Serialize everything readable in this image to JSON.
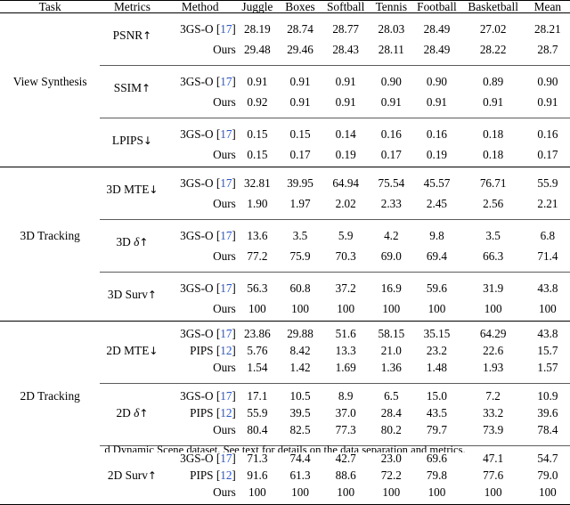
{
  "table": {
    "columns": {
      "task": "Task",
      "metrics": "Metrics",
      "method": "Method",
      "scenes": [
        "Juggle",
        "Boxes",
        "Softball",
        "Tennis",
        "Football",
        "Basketball"
      ],
      "mean": "Mean"
    },
    "citation_color": "#2b56c8",
    "methods": {
      "baseline_3gso": "3GS-O",
      "baseline_3gso_cite": "17",
      "baseline_pips": "PIPS",
      "baseline_pips_cite": "12",
      "ours": "Ours"
    },
    "sections": [
      {
        "task": "View Synthesis",
        "groups": [
          {
            "metric": "PSNR",
            "arrow": "↑",
            "rows": [
              {
                "method": "3GS-O",
                "cite": "17",
                "values": [
                  "28.19",
                  "28.74",
                  "28.77",
                  "28.03",
                  "28.49",
                  "27.02",
                  "28.21"
                ],
                "bold": [
                  false,
                  false,
                  true,
                  false,
                  true,
                  false,
                  false
                ]
              },
              {
                "method": "Ours",
                "cite": null,
                "values": [
                  "29.48",
                  "29.46",
                  "28.43",
                  "28.11",
                  "28.49",
                  "28.22",
                  "28.7"
                ],
                "bold": [
                  true,
                  true,
                  false,
                  true,
                  true,
                  true,
                  true
                ]
              }
            ]
          },
          {
            "metric": "SSIM",
            "arrow": "↑",
            "rows": [
              {
                "method": "3GS-O",
                "cite": "17",
                "values": [
                  "0.91",
                  "0.91",
                  "0.91",
                  "0.90",
                  "0.90",
                  "0.89",
                  "0.90"
                ],
                "bold": [
                  false,
                  true,
                  true,
                  false,
                  false,
                  false,
                  false
                ]
              },
              {
                "method": "Ours",
                "cite": null,
                "values": [
                  "0.92",
                  "0.91",
                  "0.91",
                  "0.91",
                  "0.91",
                  "0.91",
                  "0.91"
                ],
                "bold": [
                  true,
                  true,
                  true,
                  true,
                  true,
                  true,
                  true
                ]
              }
            ]
          },
          {
            "metric": "LPIPS",
            "arrow": "↓",
            "rows": [
              {
                "method": "3GS-O",
                "cite": "17",
                "values": [
                  "0.15",
                  "0.15",
                  "0.14",
                  "0.16",
                  "0.16",
                  "0.18",
                  "0.16"
                ],
                "bold": [
                  true,
                  true,
                  true,
                  true,
                  true,
                  true,
                  true
                ]
              },
              {
                "method": "Ours",
                "cite": null,
                "values": [
                  "0.15",
                  "0.17",
                  "0.19",
                  "0.17",
                  "0.19",
                  "0.18",
                  "0.17"
                ],
                "bold": [
                  true,
                  false,
                  false,
                  false,
                  false,
                  true,
                  true
                ]
              }
            ]
          }
        ]
      },
      {
        "task": "3D Tracking",
        "groups": [
          {
            "metric": "3D MTE",
            "arrow": "↓",
            "rows": [
              {
                "method": "3GS-O",
                "cite": "17",
                "values": [
                  "32.81",
                  "39.95",
                  "64.94",
                  "75.54",
                  "45.57",
                  "76.71",
                  "55.9"
                ],
                "bold": [
                  false,
                  false,
                  false,
                  false,
                  false,
                  false,
                  false
                ]
              },
              {
                "method": "Ours",
                "cite": null,
                "values": [
                  "1.90",
                  "1.97",
                  "2.02",
                  "2.33",
                  "2.45",
                  "2.56",
                  "2.21"
                ],
                "bold": [
                  true,
                  true,
                  true,
                  true,
                  true,
                  true,
                  true
                ]
              }
            ]
          },
          {
            "metric": "3D δ",
            "arrow": "↑",
            "italic_symbol": true,
            "rows": [
              {
                "method": "3GS-O",
                "cite": "17",
                "values": [
                  "13.6",
                  "3.5",
                  "5.9",
                  "4.2",
                  "9.8",
                  "3.5",
                  "6.8"
                ],
                "bold": [
                  false,
                  false,
                  false,
                  false,
                  false,
                  false,
                  false
                ]
              },
              {
                "method": "Ours",
                "cite": null,
                "values": [
                  "77.2",
                  "75.9",
                  "70.3",
                  "69.0",
                  "69.4",
                  "66.3",
                  "71.4"
                ],
                "bold": [
                  true,
                  true,
                  true,
                  true,
                  true,
                  true,
                  true
                ]
              }
            ]
          },
          {
            "metric": "3D Surv",
            "arrow": "↑",
            "rows": [
              {
                "method": "3GS-O",
                "cite": "17",
                "values": [
                  "56.3",
                  "60.8",
                  "37.2",
                  "16.9",
                  "59.6",
                  "31.9",
                  "43.8"
                ],
                "bold": [
                  false,
                  false,
                  false,
                  false,
                  false,
                  false,
                  false
                ]
              },
              {
                "method": "Ours",
                "cite": null,
                "values": [
                  "100",
                  "100",
                  "100",
                  "100",
                  "100",
                  "100",
                  "100"
                ],
                "bold": [
                  true,
                  true,
                  true,
                  true,
                  true,
                  true,
                  true
                ]
              }
            ]
          }
        ]
      },
      {
        "task": "2D Tracking",
        "groups": [
          {
            "metric": "2D MTE",
            "arrow": "↓",
            "rows": [
              {
                "method": "3GS-O",
                "cite": "17",
                "values": [
                  "23.86",
                  "29.88",
                  "51.6",
                  "58.15",
                  "35.15",
                  "64.29",
                  "43.8"
                ],
                "bold": [
                  false,
                  false,
                  false,
                  false,
                  false,
                  false,
                  false
                ]
              },
              {
                "method": "PIPS",
                "cite": "12",
                "values": [
                  "5.76",
                  "8.42",
                  "13.3",
                  "21.0",
                  "23.2",
                  "22.6",
                  "15.7"
                ],
                "bold": [
                  false,
                  false,
                  false,
                  false,
                  false,
                  false,
                  false
                ]
              },
              {
                "method": "Ours",
                "cite": null,
                "values": [
                  "1.54",
                  "1.42",
                  "1.69",
                  "1.36",
                  "1.48",
                  "1.93",
                  "1.57"
                ],
                "bold": [
                  true,
                  true,
                  true,
                  true,
                  true,
                  true,
                  true
                ]
              }
            ]
          },
          {
            "metric": "2D δ",
            "arrow": "↑",
            "italic_symbol": true,
            "rows": [
              {
                "method": "3GS-O",
                "cite": "17",
                "values": [
                  "17.1",
                  "10.5",
                  "8.9",
                  "6.5",
                  "15.0",
                  "7.2",
                  "10.9"
                ],
                "bold": [
                  false,
                  false,
                  false,
                  false,
                  false,
                  false,
                  false
                ]
              },
              {
                "method": "PIPS",
                "cite": "12",
                "values": [
                  "55.9",
                  "39.5",
                  "37.0",
                  "28.4",
                  "43.5",
                  "33.2",
                  "39.6"
                ],
                "bold": [
                  false,
                  false,
                  false,
                  false,
                  false,
                  false,
                  false
                ]
              },
              {
                "method": "Ours",
                "cite": null,
                "values": [
                  "80.4",
                  "82.5",
                  "77.3",
                  "80.2",
                  "79.7",
                  "73.9",
                  "78.4"
                ],
                "bold": [
                  true,
                  true,
                  true,
                  true,
                  true,
                  true,
                  true
                ]
              }
            ]
          },
          {
            "metric": "2D Surv",
            "arrow": "↑",
            "rows": [
              {
                "method": "3GS-O",
                "cite": "17",
                "values": [
                  "71.3",
                  "74.4",
                  "42.7",
                  "23.0",
                  "69.6",
                  "47.1",
                  "54.7"
                ],
                "bold": [
                  false,
                  false,
                  false,
                  false,
                  false,
                  false,
                  false
                ]
              },
              {
                "method": "PIPS",
                "cite": "12",
                "values": [
                  "91.6",
                  "61.3",
                  "88.6",
                  "72.2",
                  "79.8",
                  "77.6",
                  "79.0"
                ],
                "bold": [
                  false,
                  false,
                  false,
                  false,
                  false,
                  false,
                  false
                ]
              },
              {
                "method": "Ours",
                "cite": null,
                "values": [
                  "100",
                  "100",
                  "100",
                  "100",
                  "100",
                  "100",
                  "100"
                ],
                "bold": [
                  true,
                  true,
                  true,
                  true,
                  true,
                  true,
                  true
                ]
              }
            ]
          }
        ]
      }
    ]
  },
  "caption": {
    "text": "d Dynamic Scene dataset. See text for details on the data separation and metrics."
  }
}
